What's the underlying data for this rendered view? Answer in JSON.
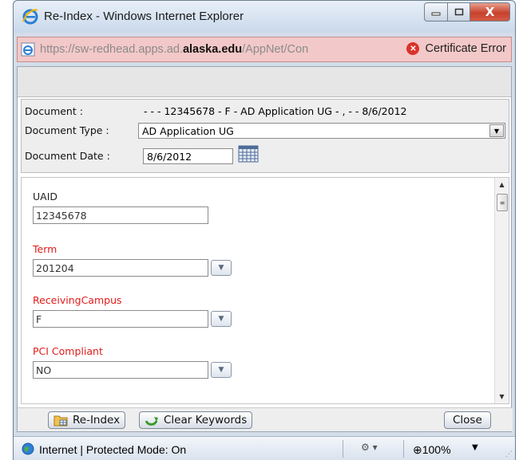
{
  "window": {
    "title": "Re-Index - Windows Internet Explorer",
    "close_glyph": "X"
  },
  "address": {
    "url_prefix": "https://sw-redhead.apps.ad.",
    "url_domain": "alaska.edu",
    "url_suffix": "/AppNet/Con",
    "certificate_label": "Certificate Error"
  },
  "header": {
    "document_label": "Document :",
    "document_value": "- - - 12345678 - F - AD Application UG - , - - 8/6/2012",
    "document_type_label": "Document Type :",
    "document_type_value": "AD Application UG",
    "document_date_label": "Document Date :",
    "document_date_value": "8/6/2012"
  },
  "form": {
    "fields": [
      {
        "label": "UAID",
        "value": "12345678",
        "required": false
      },
      {
        "label": "Term",
        "value": "201204",
        "required": true
      },
      {
        "label": "ReceivingCampus",
        "value": "F",
        "required": true
      },
      {
        "label": "PCI Compliant",
        "value": "NO",
        "required": true
      }
    ]
  },
  "buttons": {
    "reindex": "Re-Index",
    "clear": "Clear Keywords",
    "close": "Close"
  },
  "status": {
    "zone_text": "Internet | Protected Mode: On",
    "zoom": "100%"
  },
  "colors": {
    "required_label": "#e11a1a",
    "address_bar_error": "#f3c8c8",
    "close_button": "#c8412c"
  }
}
